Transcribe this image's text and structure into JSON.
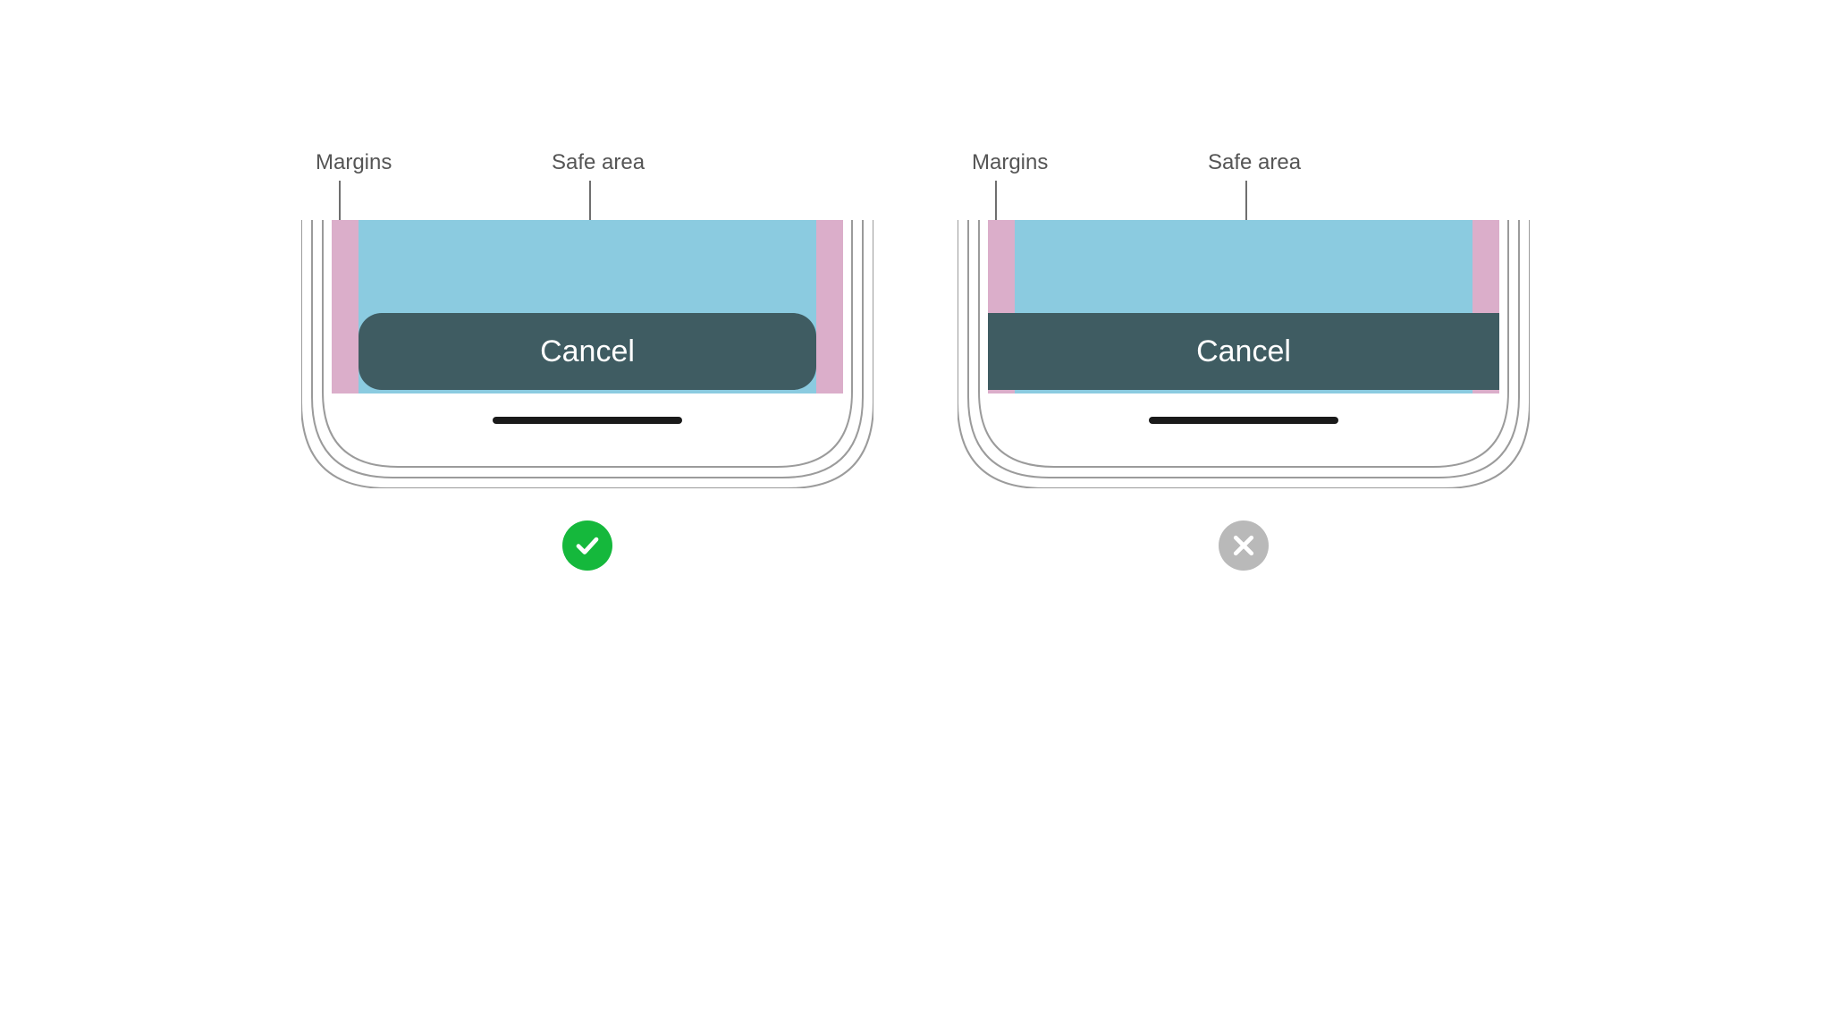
{
  "labels": {
    "margins": "Margins",
    "safe_area": "Safe area"
  },
  "examples": {
    "correct": {
      "button_label": "Cancel",
      "indicator": "check"
    },
    "incorrect": {
      "button_label": "Cancel",
      "indicator": "cross"
    }
  },
  "colors": {
    "safe_area": "#8bcbe0",
    "margin": "#e9a9c5",
    "button_bg": "#3f5c62",
    "button_text": "#ffffff",
    "check_bg": "#15b83c",
    "cross_bg": "#b9b9b9",
    "label_text": "#555555"
  }
}
